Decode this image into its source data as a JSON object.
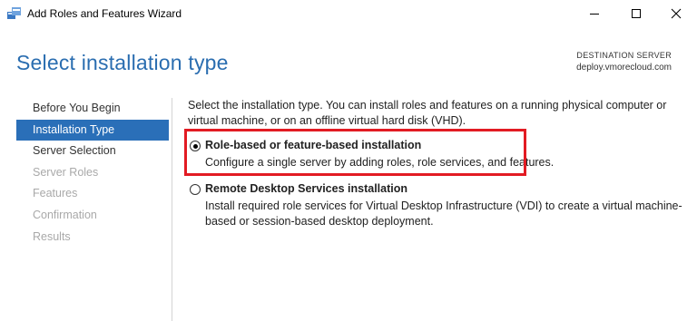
{
  "window": {
    "title": "Add Roles and Features Wizard",
    "controls": [
      "minimize-icon",
      "maximize-icon",
      "close-icon"
    ]
  },
  "header": {
    "page_title": "Select installation type",
    "destination_label": "DESTINATION SERVER",
    "destination_value": "deploy.vmorecloud.com"
  },
  "nav": {
    "items": [
      {
        "label": "Before You Begin",
        "state": "normal"
      },
      {
        "label": "Installation Type",
        "state": "active"
      },
      {
        "label": "Server Selection",
        "state": "normal"
      },
      {
        "label": "Server Roles",
        "state": "disabled"
      },
      {
        "label": "Features",
        "state": "disabled"
      },
      {
        "label": "Confirmation",
        "state": "disabled"
      },
      {
        "label": "Results",
        "state": "disabled"
      }
    ]
  },
  "main": {
    "intro": "Select the installation type. You can install roles and features on a running physical computer or virtual machine, or on an offline virtual hard disk (VHD).",
    "options": [
      {
        "label": "Role-based or feature-based installation",
        "description": "Configure a single server by adding roles, role services, and features.",
        "selected": true
      },
      {
        "label": "Remote Desktop Services installation",
        "description": "Install required role services for Virtual Desktop Infrastructure (VDI) to create a virtual machine-based or session-based desktop deployment.",
        "selected": false
      }
    ]
  },
  "colors": {
    "accent": "#2a6fb8",
    "title_blue": "#2a6db0",
    "highlight_red": "#e21b23",
    "disabled_text": "#a9a9a9"
  }
}
